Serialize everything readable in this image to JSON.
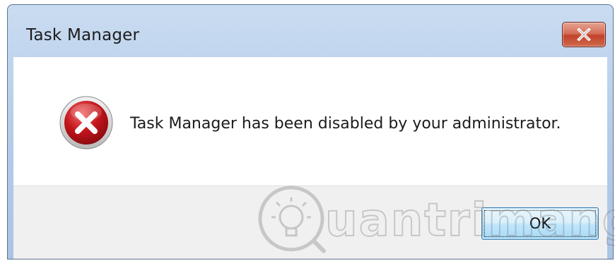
{
  "window": {
    "title": "Task Manager",
    "close_icon": "close-icon"
  },
  "dialog": {
    "icon": "error-icon",
    "message": "Task Manager has been disabled by your administrator."
  },
  "buttons": {
    "ok_label": "OK"
  },
  "watermark": {
    "text": "uantrimang",
    "logo": "quantrimang-logo"
  },
  "colors": {
    "titlebar": "#b7cde9",
    "close_button": "#c2432b",
    "error_icon": "#c4161c",
    "footer": "#f0f0f0",
    "ok_button": "#bee6fd"
  }
}
